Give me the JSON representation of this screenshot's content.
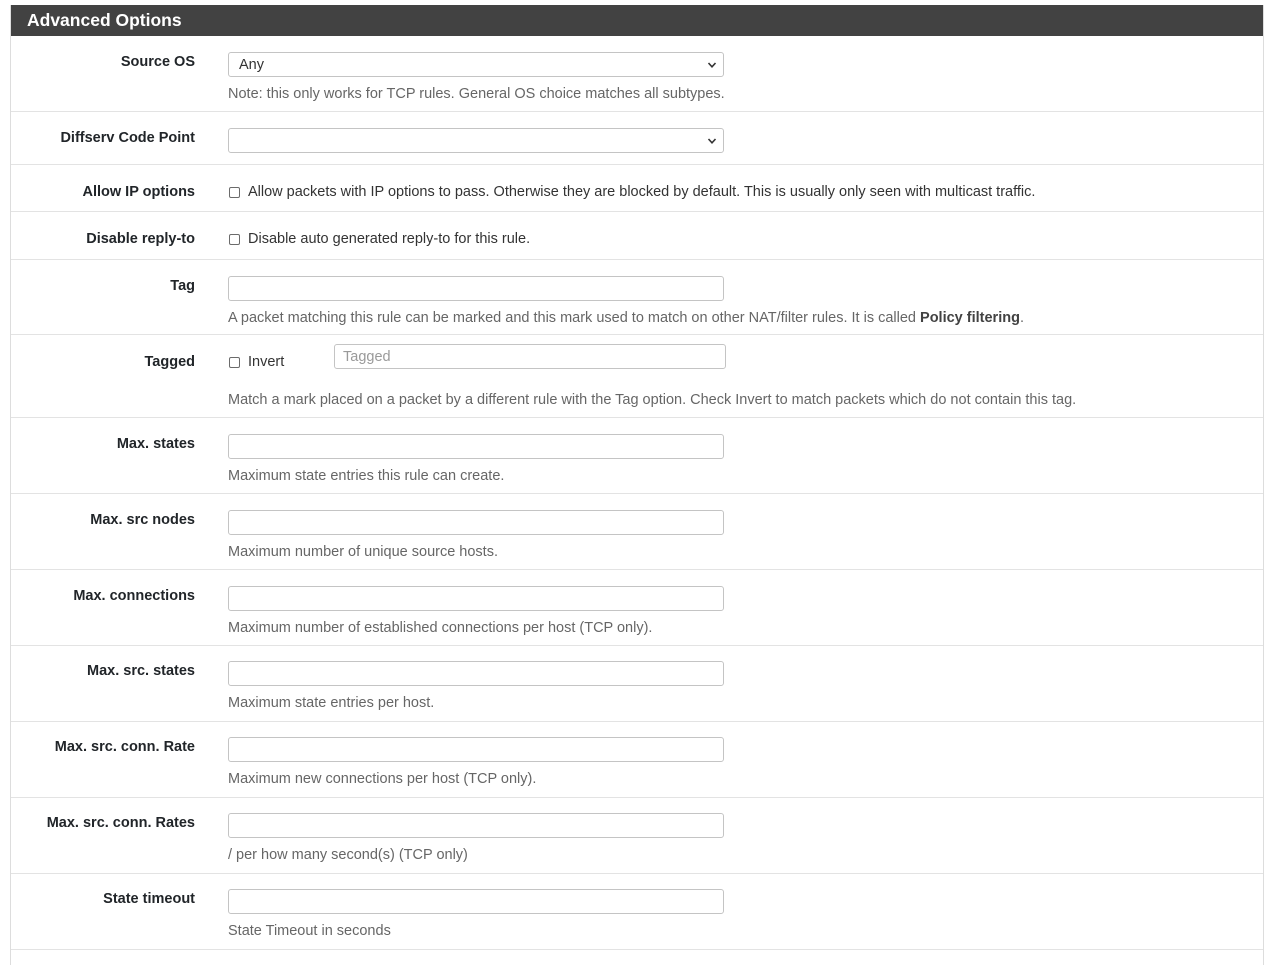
{
  "panel": {
    "title": "Advanced Options"
  },
  "fields": {
    "source_os": {
      "label": "Source OS",
      "value": "Any",
      "help": "Note: this only works for TCP rules. General OS choice matches all subtypes."
    },
    "dscp": {
      "label": "Diffserv Code Point",
      "value": ""
    },
    "allow_ip_options": {
      "label": "Allow IP options",
      "checkbox_text": "Allow packets with IP options to pass. Otherwise they are blocked by default. This is usually only seen with multicast traffic."
    },
    "disable_reply_to": {
      "label": "Disable reply-to",
      "checkbox_text": "Disable auto generated reply-to for this rule."
    },
    "tag": {
      "label": "Tag",
      "value": "",
      "help_prefix": "A packet matching this rule can be marked and this mark used to match on other NAT/filter rules. It is called ",
      "help_bold": "Policy filtering",
      "help_suffix": "."
    },
    "tagged": {
      "label": "Tagged",
      "invert_text": "Invert",
      "placeholder": "Tagged",
      "help": "Match a mark placed on a packet by a different rule with the Tag option. Check Invert to match packets which do not contain this tag."
    },
    "max_states": {
      "label": "Max. states",
      "value": "",
      "help": "Maximum state entries this rule can create."
    },
    "max_src_nodes": {
      "label": "Max. src nodes",
      "value": "",
      "help": "Maximum number of unique source hosts."
    },
    "max_connections": {
      "label": "Max. connections",
      "value": "",
      "help": "Maximum number of established connections per host (TCP only)."
    },
    "max_src_states": {
      "label": "Max. src. states",
      "value": "",
      "help": "Maximum state entries per host."
    },
    "max_src_conn_rate": {
      "label": "Max. src. conn. Rate",
      "value": "",
      "help": "Maximum new connections per host (TCP only)."
    },
    "max_src_conn_rates": {
      "label": "Max. src. conn. Rates",
      "value": "",
      "help": "/ per how many second(s) (TCP only)"
    },
    "state_timeout": {
      "label": "State timeout",
      "value": "",
      "help": "State Timeout in seconds"
    }
  }
}
